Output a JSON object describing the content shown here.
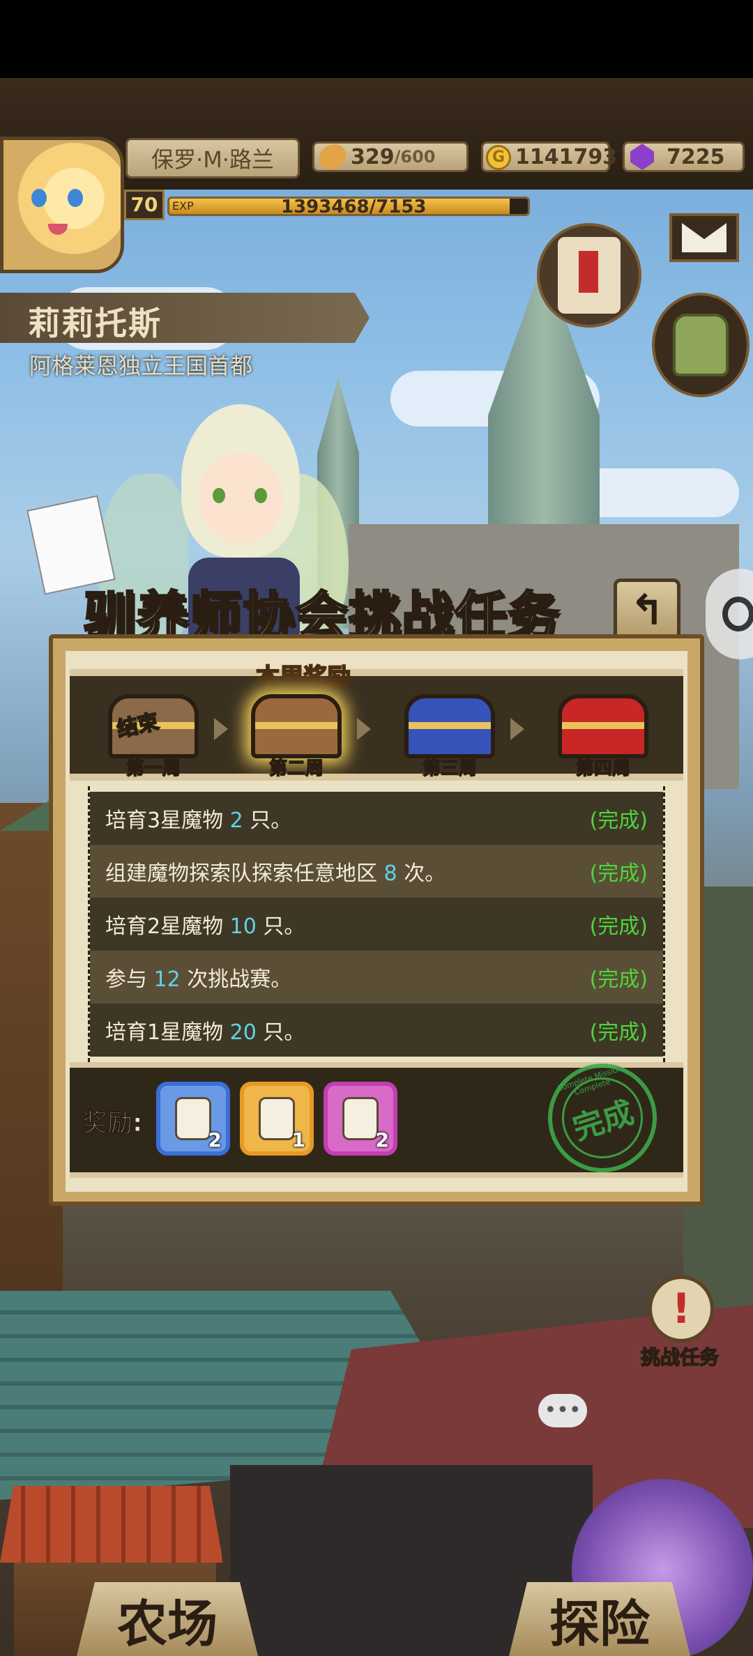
{
  "player": {
    "name": "保罗·M·路兰",
    "level": "70",
    "exp_label": "EXP",
    "exp_text": "1393468/7153",
    "exp_progress": 0.95,
    "bread": "329",
    "bread_max": "/600",
    "gold": "1141793",
    "gems": "7225"
  },
  "location": {
    "title": "莉莉托斯",
    "subtitle": "阿格莱恩独立王国首都"
  },
  "dialog": {
    "title": "驯养师协会挑战任务",
    "this_week_badge": "本周奖励",
    "weeks": [
      {
        "label": "第一周",
        "state": "结束",
        "color": "#8a6a48"
      },
      {
        "label": "第二周",
        "state": "",
        "color": "#9a6a3e"
      },
      {
        "label": "第三周",
        "state": "",
        "color": "#3553b8"
      },
      {
        "label": "第四周",
        "state": "",
        "color": "#c92626"
      }
    ],
    "tasks": [
      {
        "pre": "培育3星魔物",
        "num": "2",
        "post": "只。",
        "status": "(完成)"
      },
      {
        "pre": "组建魔物探索队探索任意地区",
        "num": "8",
        "post": "次。",
        "status": "(完成)"
      },
      {
        "pre": "培育2星魔物",
        "num": "10",
        "post": "只。",
        "status": "(完成)"
      },
      {
        "pre": "参与",
        "num": "12",
        "post": "次挑战赛。",
        "status": "(完成)"
      },
      {
        "pre": "培育1星魔物",
        "num": "20",
        "post": "只。",
        "status": "(完成)"
      }
    ],
    "reward_label": "奖励:",
    "rewards": [
      {
        "count": "2",
        "border": "#3b6fd6",
        "bg": "#6a9ae6",
        "icon": "scroll-icon"
      },
      {
        "count": "1",
        "border": "#e69a24",
        "bg": "#f0b64a",
        "icon": "potion-icon"
      },
      {
        "count": "2",
        "border": "#c23fb0",
        "bg": "#d96ac8",
        "icon": "lantern-icon"
      }
    ],
    "stamp_text": "完成",
    "stamp_ring": "Complete Mission Complete"
  },
  "side": {
    "challenge_label": "挑战任务"
  },
  "bottom_nav": {
    "farm": "农场",
    "explore": "探险"
  }
}
